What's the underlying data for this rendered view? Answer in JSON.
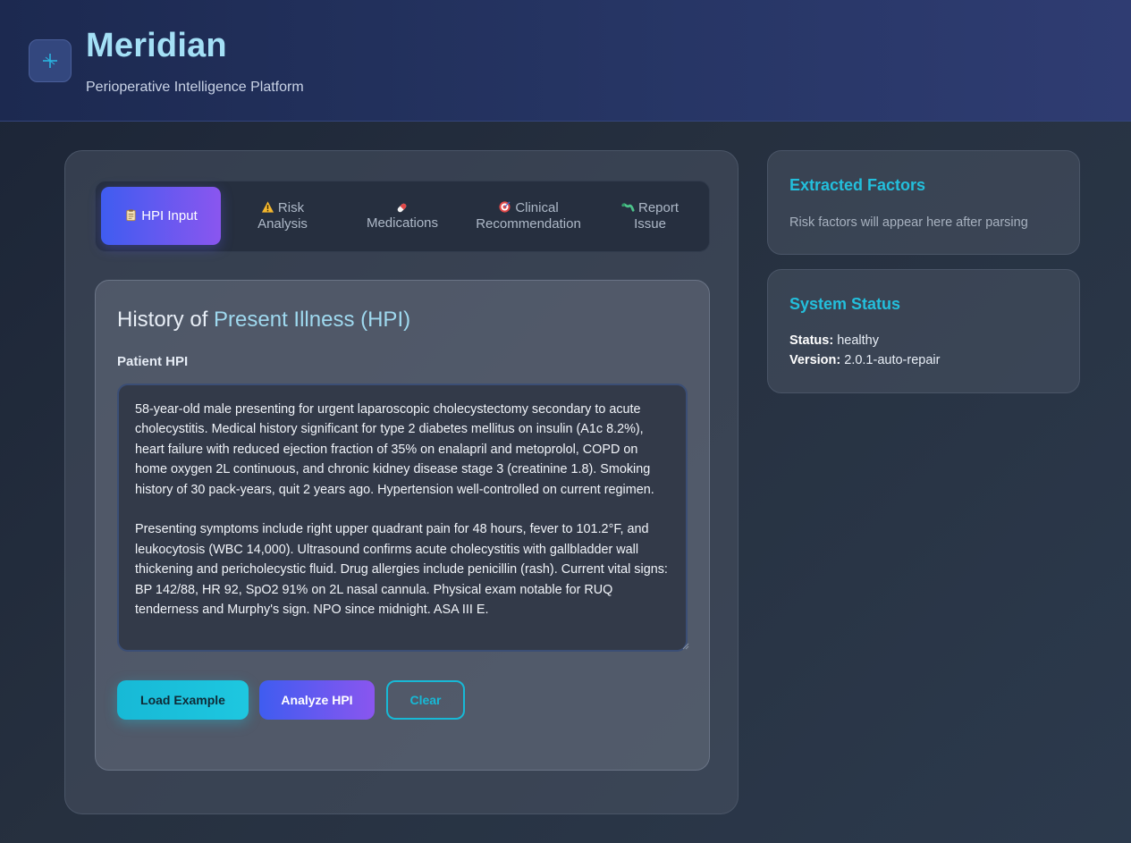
{
  "header": {
    "title": "Meridian",
    "subtitle": "Perioperative Intelligence Platform",
    "logo_icon": "sparkle-icon"
  },
  "tabs": [
    {
      "label": "HPI Input",
      "icon": "clipboard-icon",
      "active": true
    },
    {
      "label": "Risk\nAnalysis",
      "icon": "warning-icon",
      "active": false
    },
    {
      "label": "Medications",
      "icon": "pill-icon",
      "active": false
    },
    {
      "label": "Clinical\nRecommendation",
      "icon": "target-icon",
      "active": false
    },
    {
      "label": "Report\nIssue",
      "icon": "bug-icon",
      "active": false
    }
  ],
  "hpi": {
    "title_prefix": "History of ",
    "title_accent": "Present Illness (HPI)",
    "field_label": "Patient HPI",
    "text": "58-year-old male presenting for urgent laparoscopic cholecystectomy secondary to acute cholecystitis. Medical history significant for type 2 diabetes mellitus on insulin (A1c 8.2%), heart failure with reduced ejection fraction of 35% on enalapril and metoprolol, COPD on home oxygen 2L continuous, and chronic kidney disease stage 3 (creatinine 1.8). Smoking history of 30 pack-years, quit 2 years ago. Hypertension well-controlled on current regimen.\n\nPresenting symptoms include right upper quadrant pain for 48 hours, fever to 101.2°F, and leukocytosis (WBC 14,000). Ultrasound confirms acute cholecystitis with gallbladder wall thickening and pericholecystic fluid. Drug allergies include penicillin (rash). Current vital signs: BP 142/88, HR 92, SpO2 91% on 2L nasal cannula. Physical exam notable for RUQ tenderness and Murphy's sign. NPO since midnight. ASA III E.",
    "buttons": {
      "load": "Load Example",
      "analyze": "Analyze HPI",
      "clear": "Clear"
    }
  },
  "factors": {
    "title": "Extracted Factors",
    "placeholder": "Risk factors will appear here after parsing"
  },
  "system_status": {
    "title": "System Status",
    "status_label": "Status:",
    "status_value": "healthy",
    "version_label": "Version:",
    "version_value": "2.0.1-auto-repair"
  },
  "colors": {
    "accent_cyan": "#17b9d6",
    "accent_gradient_start": "#3f5cf0",
    "accent_gradient_end": "#8a56ef",
    "title_blue": "#a4e0f6"
  }
}
